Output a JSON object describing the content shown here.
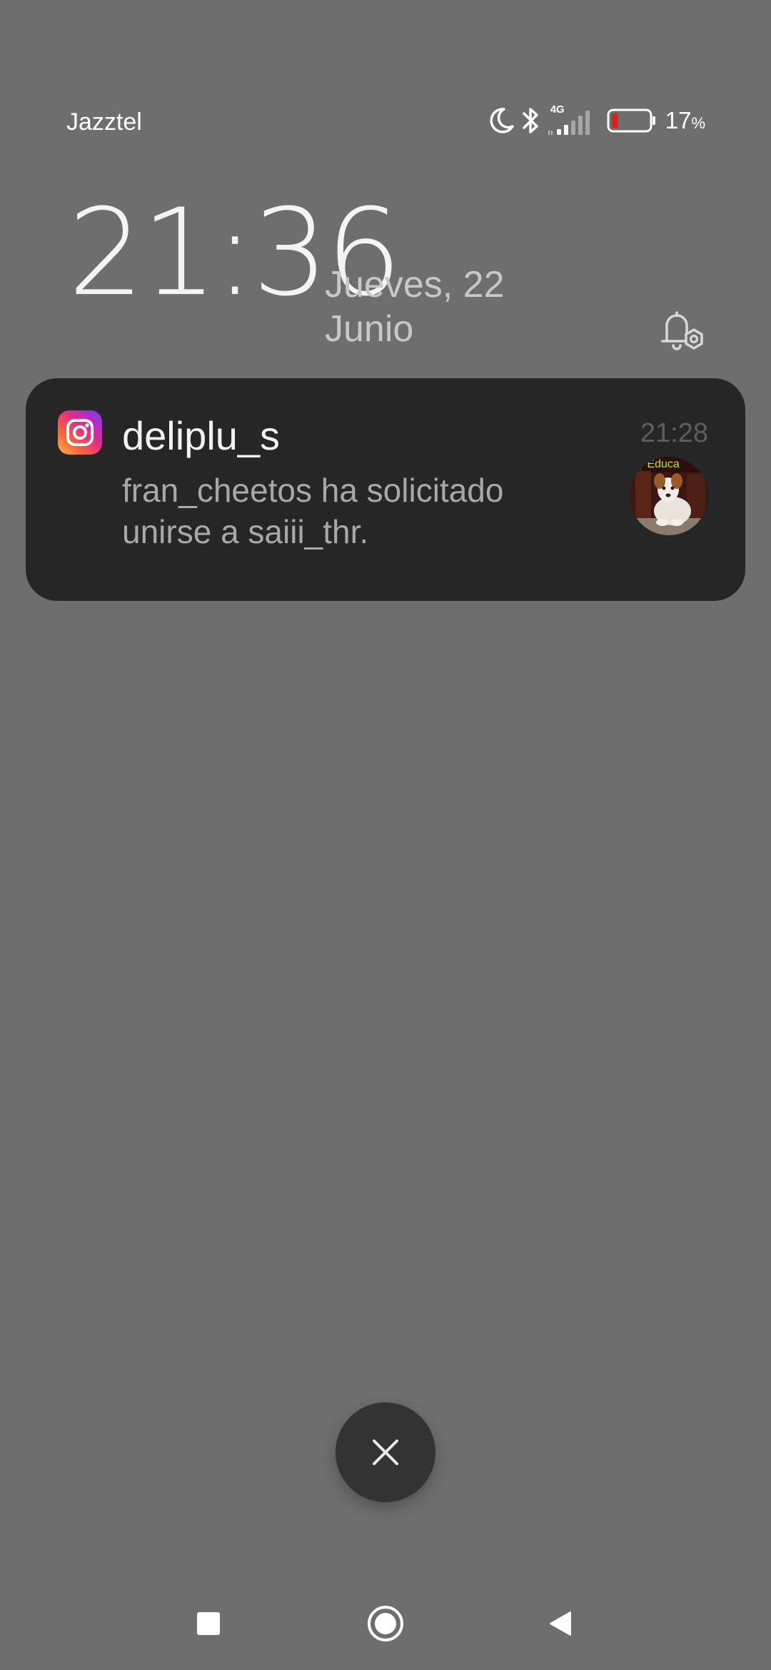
{
  "status_bar": {
    "carrier": "Jazztel",
    "network_label": "4G",
    "battery_percent": "17",
    "battery_percent_sign": "%",
    "battery_level": 0.17,
    "icons": [
      "moon-icon",
      "bluetooth-icon",
      "signal-icon",
      "battery-icon"
    ]
  },
  "lockscreen": {
    "time": "21:36",
    "date_line1": "Jueves, 22",
    "date_line2": "Junio"
  },
  "notification": {
    "app": "Instagram",
    "title": "deliplu_s",
    "time": "21:28",
    "body": "fran_cheetos ha solicitado unirse a saiii_thr.",
    "avatar_caption": "y Educa"
  },
  "colors": {
    "background": "#6e6e6e",
    "card": "#262626",
    "battery_low": "#e02020"
  }
}
